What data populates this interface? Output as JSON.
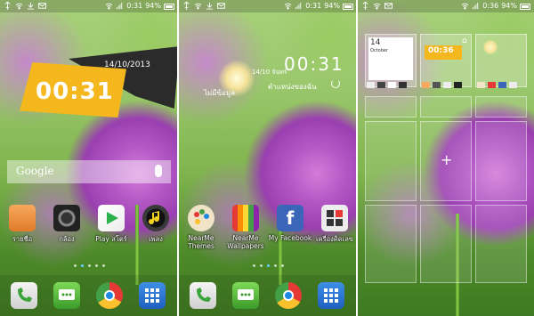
{
  "screens": [
    {
      "status": {
        "battery_percent": "94%",
        "time": "0:31"
      },
      "clock_widget": {
        "date": "14/10/2013",
        "time": "00:31"
      },
      "search": {
        "label": "Google"
      },
      "apps": [
        {
          "label": "รายชื่อ",
          "icon": "contacts-icon"
        },
        {
          "label": "กล้อง",
          "icon": "camera-icon"
        },
        {
          "label": "Play สโตร์",
          "icon": "play-store-icon"
        },
        {
          "label": "เพลง",
          "icon": "music-icon"
        }
      ]
    },
    {
      "status": {
        "battery_percent": "94%",
        "time": "0:31"
      },
      "clock_widget": {
        "time": "00:31",
        "date": "14/10 จันทร์",
        "weather": "ไม่มีข้อมูล",
        "location": "ตำแหน่งของฉัน"
      },
      "apps": [
        {
          "label": "NearMe Themes",
          "icon": "themes-palette-icon"
        },
        {
          "label": "NearMe Wallpapers",
          "icon": "wallpapers-icon"
        },
        {
          "label": "My Facebook",
          "icon": "facebook-icon"
        },
        {
          "label": "เครื่องคิดเลข",
          "icon": "calculator-icon"
        }
      ]
    },
    {
      "status": {
        "battery_percent": "94%",
        "time": "0:36"
      },
      "calendar_preview": {
        "day": "14",
        "month": "October"
      },
      "clock_preview": {
        "time": "00:36"
      }
    }
  ],
  "dock": [
    {
      "icon": "phone-icon"
    },
    {
      "icon": "messages-icon"
    },
    {
      "icon": "chrome-icon"
    },
    {
      "icon": "app-drawer-icon"
    }
  ],
  "colors": {
    "accent_yellow": "#f4b81e",
    "dot_active": "#6ad0ff"
  }
}
